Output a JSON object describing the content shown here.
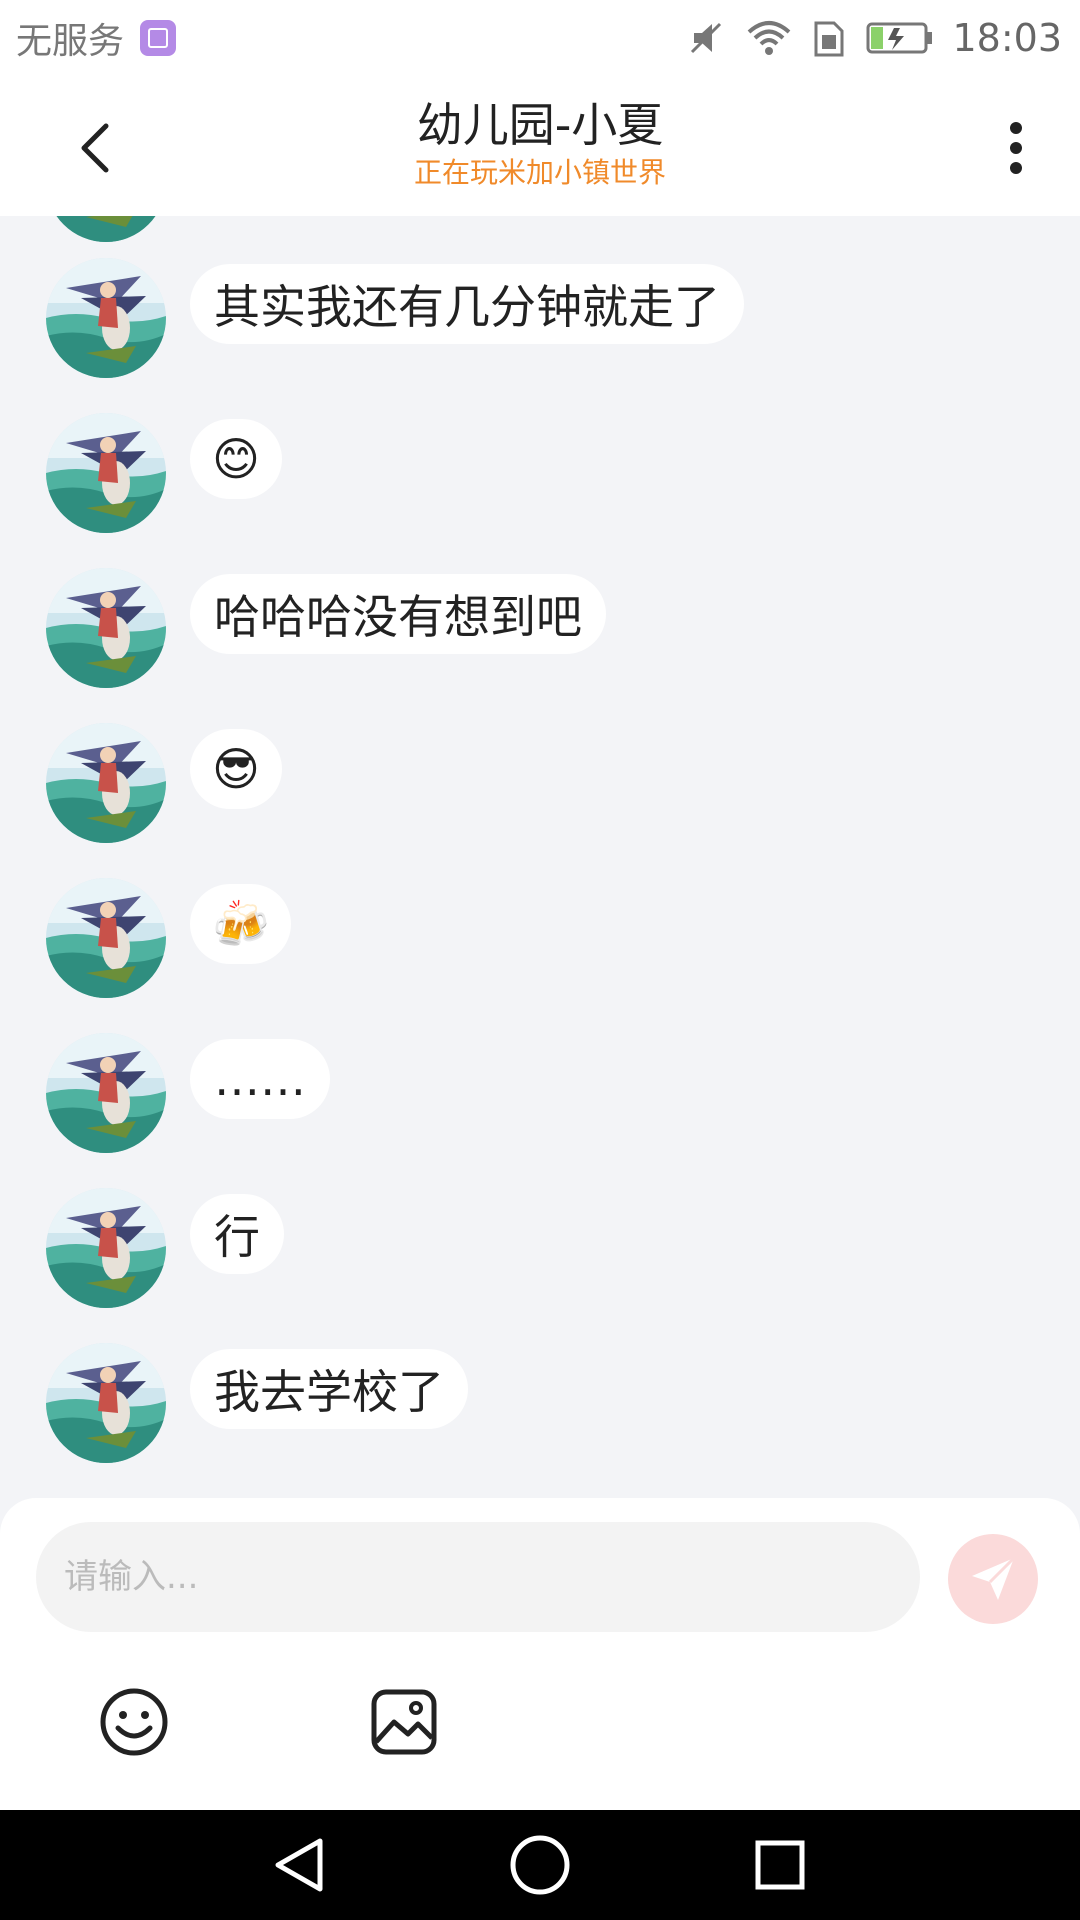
{
  "status_bar": {
    "carrier": "无服务",
    "time": "18:03",
    "icons": [
      "gallery-app-icon",
      "mute-icon",
      "wifi-icon",
      "sim-icon",
      "battery-charging-icon"
    ]
  },
  "header": {
    "title": "幼儿园-小夏",
    "subtitle": "正在玩米加小镇世界",
    "back_icon": "chevron-left-icon",
    "more_icon": "more-vertical-icon"
  },
  "messages": [
    {
      "text": "其实我还有几分钟就走了",
      "kind": "text"
    },
    {
      "text": "😊",
      "kind": "emoji",
      "icon": "smile-emoji"
    },
    {
      "text": "哈哈哈没有想到吧",
      "kind": "text"
    },
    {
      "text": "😎",
      "kind": "emoji",
      "icon": "sunglasses-emoji"
    },
    {
      "text": "🍻",
      "kind": "emoji",
      "icon": "beer-cheers-emoji"
    },
    {
      "text": "……",
      "kind": "text"
    },
    {
      "text": "行",
      "kind": "text"
    },
    {
      "text": "我去学校了",
      "kind": "text"
    }
  ],
  "input": {
    "placeholder": "请输入...",
    "value": ""
  },
  "toolbar": {
    "emoji_icon": "emoji-icon",
    "image_icon": "image-icon",
    "send_icon": "send-icon"
  },
  "colors": {
    "accent_orange": "#f08a2a",
    "send_button_bg": "#fbdada",
    "chat_bg": "#f3f4f7"
  }
}
